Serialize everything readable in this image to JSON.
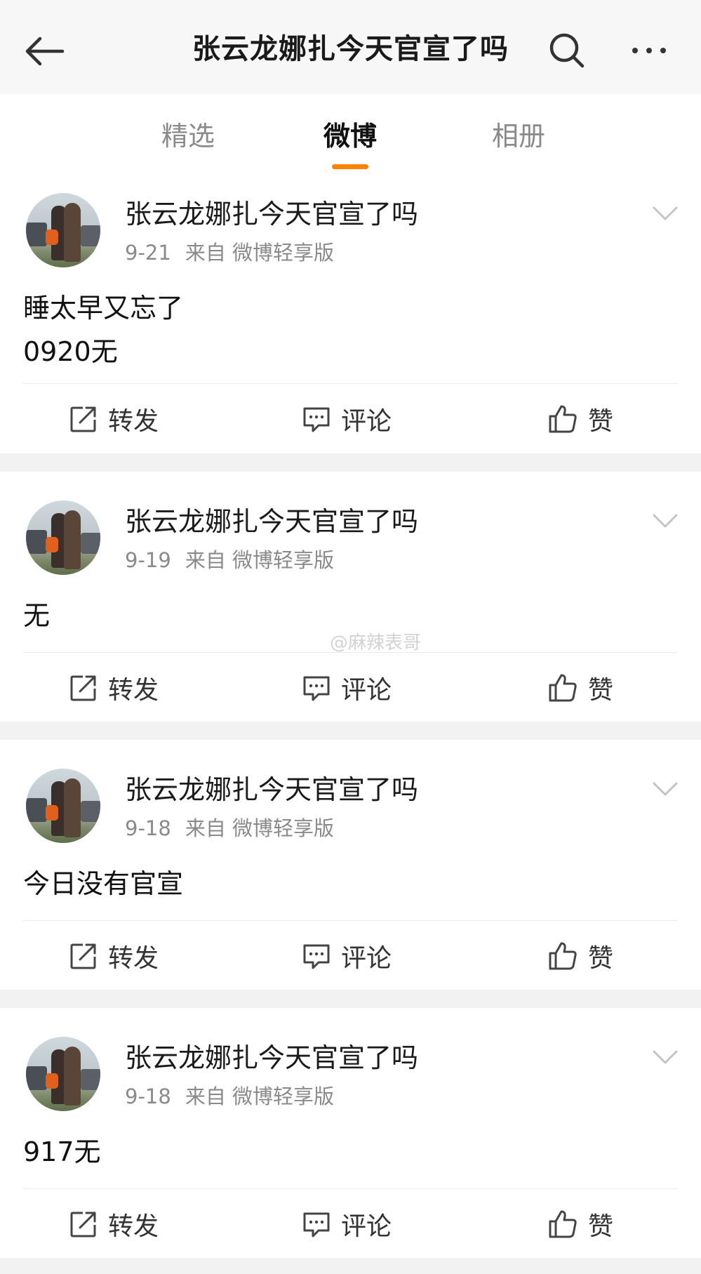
{
  "header": {
    "title": "张云龙娜扎今天官宣了吗",
    "icons": [
      "back-arrow-icon",
      "search-icon",
      "more-icon"
    ]
  },
  "tabs": [
    {
      "label": "精选",
      "active": false
    },
    {
      "label": "微博",
      "active": true
    },
    {
      "label": "相册",
      "active": false
    }
  ],
  "accent_color": "#ff8200",
  "posts": [
    {
      "username": "张云龙娜扎今天官宣了吗",
      "date": "9-21",
      "source": "来自 微博轻享版",
      "text": "睡太早又忘了\n0920无"
    },
    {
      "username": "张云龙娜扎今天官宣了吗",
      "date": "9-19",
      "source": "来自 微博轻享版",
      "text": "无"
    },
    {
      "username": "张云龙娜扎今天官宣了吗",
      "date": "9-18",
      "source": "来自 微博轻享版",
      "text": "今日没有官宣"
    },
    {
      "username": "张云龙娜扎今天官宣了吗",
      "date": "9-18",
      "source": "来自 微博轻享版",
      "text": "917无"
    }
  ],
  "actions": {
    "repost": "转发",
    "comment": "评论",
    "like": "赞"
  },
  "watermark": "@麻辣表哥"
}
